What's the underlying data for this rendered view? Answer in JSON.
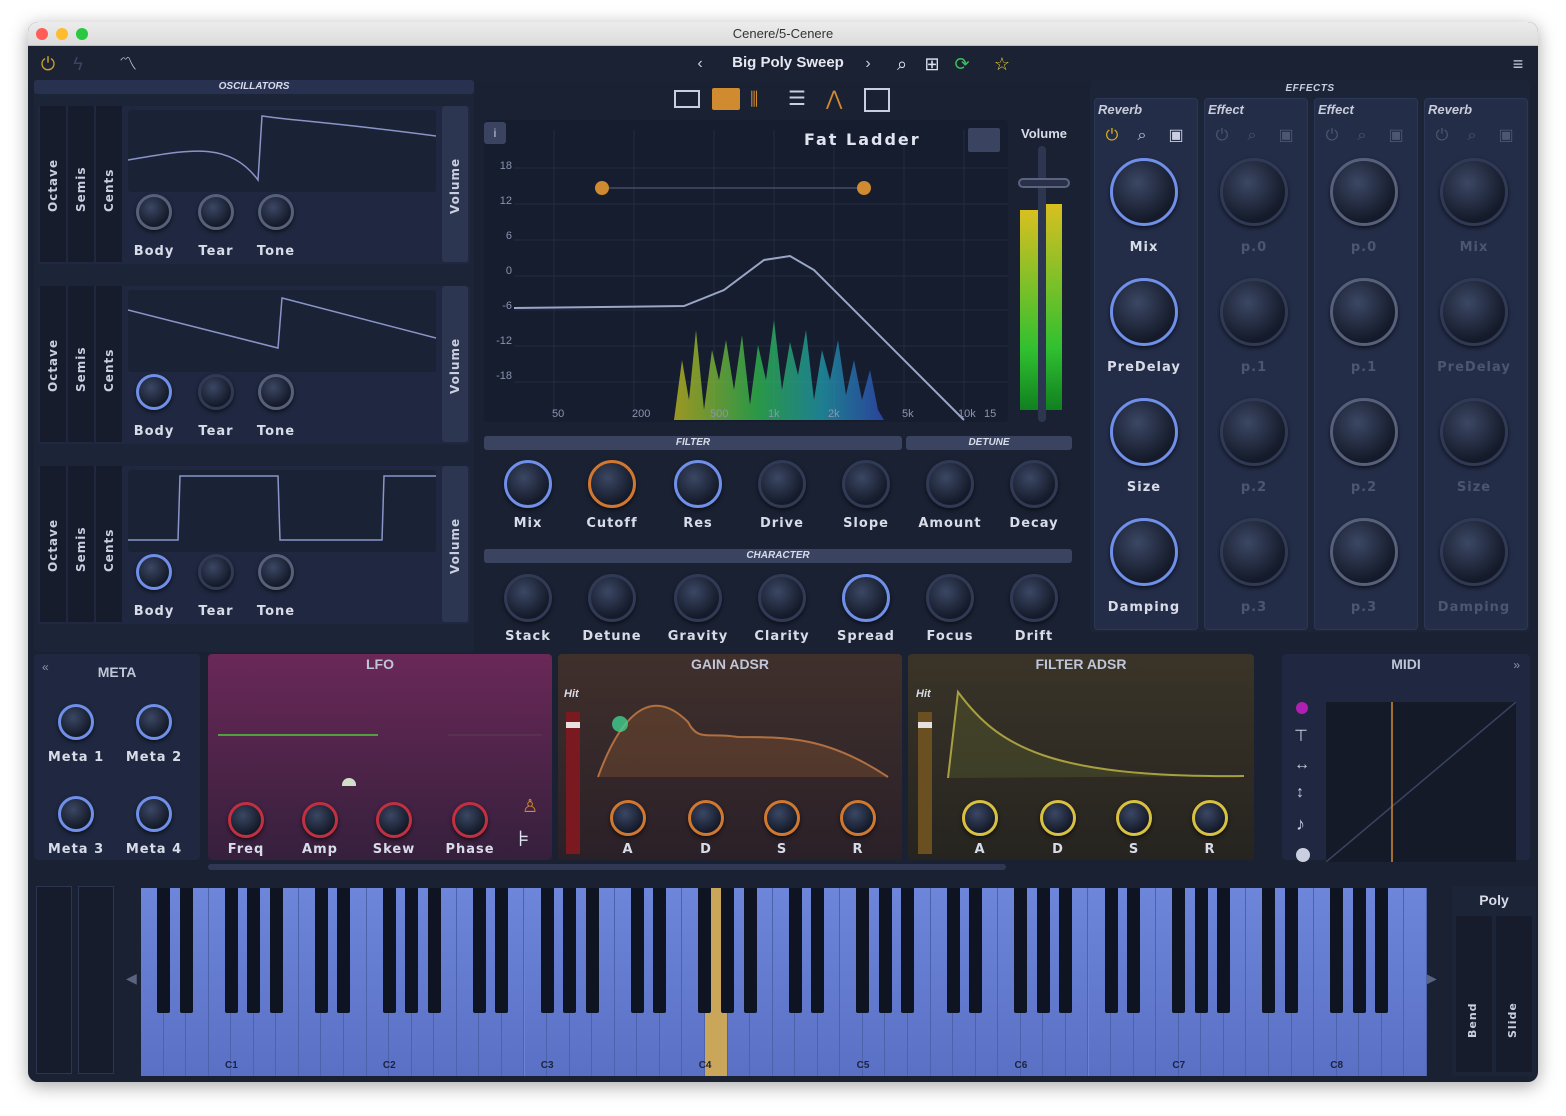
{
  "window": {
    "title": "Cenere/5-Cenere"
  },
  "toolbar": {
    "preset_name": "Big Poly Sweep",
    "prev_icon": "chevron-left-icon",
    "next_icon": "chevron-right-icon",
    "icons": [
      "power-icon",
      "bolt-icon",
      "curve-icon",
      "search-icon",
      "add-preset-icon",
      "refresh-icon",
      "star-icon",
      "menu-icon"
    ]
  },
  "oscillators": {
    "title": "OSCILLATORS",
    "strip_labels": [
      "Octave",
      "Semis",
      "Cents"
    ],
    "volume_label": "Volume",
    "knob_labels": [
      "Body",
      "Tear",
      "Tone"
    ]
  },
  "view_tabs": [
    "split-view-icon",
    "keyboard-view-icon",
    "mixer-view-icon",
    "list-view-icon",
    "filter-view-icon",
    "blank-view-icon"
  ],
  "filter_display": {
    "name": "Fat Ladder",
    "db_ticks": [
      "18",
      "12",
      "6",
      "0",
      "-6",
      "-12",
      "-18"
    ],
    "freq_ticks": [
      "50",
      "200",
      "500",
      "1k",
      "2k",
      "5k",
      "10k",
      "15"
    ],
    "volume_label": "Volume"
  },
  "filter_section": {
    "title": "FILTER",
    "knobs": [
      "Mix",
      "Cutoff",
      "Res",
      "Drive",
      "Slope"
    ]
  },
  "detune_section": {
    "title": "DETUNE",
    "knobs": [
      "Amount",
      "Decay"
    ]
  },
  "character_section": {
    "title": "CHARACTER",
    "knobs": [
      "Stack",
      "Detune",
      "Gravity",
      "Clarity",
      "Spread",
      "Focus",
      "Drift"
    ]
  },
  "effects": {
    "title": "EFFECTS",
    "columns": [
      {
        "name": "Reverb",
        "params": [
          "Mix",
          "PreDelay",
          "Size",
          "Damping"
        ],
        "active": true
      },
      {
        "name": "Effect",
        "params": [
          "p.0",
          "p.1",
          "p.2",
          "p.3"
        ],
        "active": false
      },
      {
        "name": "Effect",
        "params": [
          "p.0",
          "p.1",
          "p.2",
          "p.3"
        ],
        "active": false
      },
      {
        "name": "Reverb",
        "params": [
          "Mix",
          "PreDelay",
          "Size",
          "Damping"
        ],
        "active": false
      }
    ]
  },
  "meta": {
    "title": "META",
    "collapse": "«",
    "knobs": [
      "Meta 1",
      "Meta 2",
      "Meta 3",
      "Meta 4"
    ]
  },
  "lfo": {
    "title": "LFO",
    "knobs": [
      "Freq",
      "Amp",
      "Skew",
      "Phase"
    ]
  },
  "gain_adsr": {
    "title": "GAIN ADSR",
    "hit": "Hit",
    "knobs": [
      "A",
      "D",
      "S",
      "R"
    ]
  },
  "filter_adsr": {
    "title": "FILTER ADSR",
    "hit": "Hit",
    "knobs": [
      "A",
      "D",
      "S",
      "R"
    ]
  },
  "midi": {
    "title": "MIDI",
    "expand": "»"
  },
  "keyboard": {
    "octaves": [
      "C1",
      "C2",
      "C3",
      "C4",
      "C5",
      "C6",
      "C7",
      "C8"
    ],
    "mode": "Poly",
    "bend_label": "Bend",
    "slide_label": "Slide"
  }
}
